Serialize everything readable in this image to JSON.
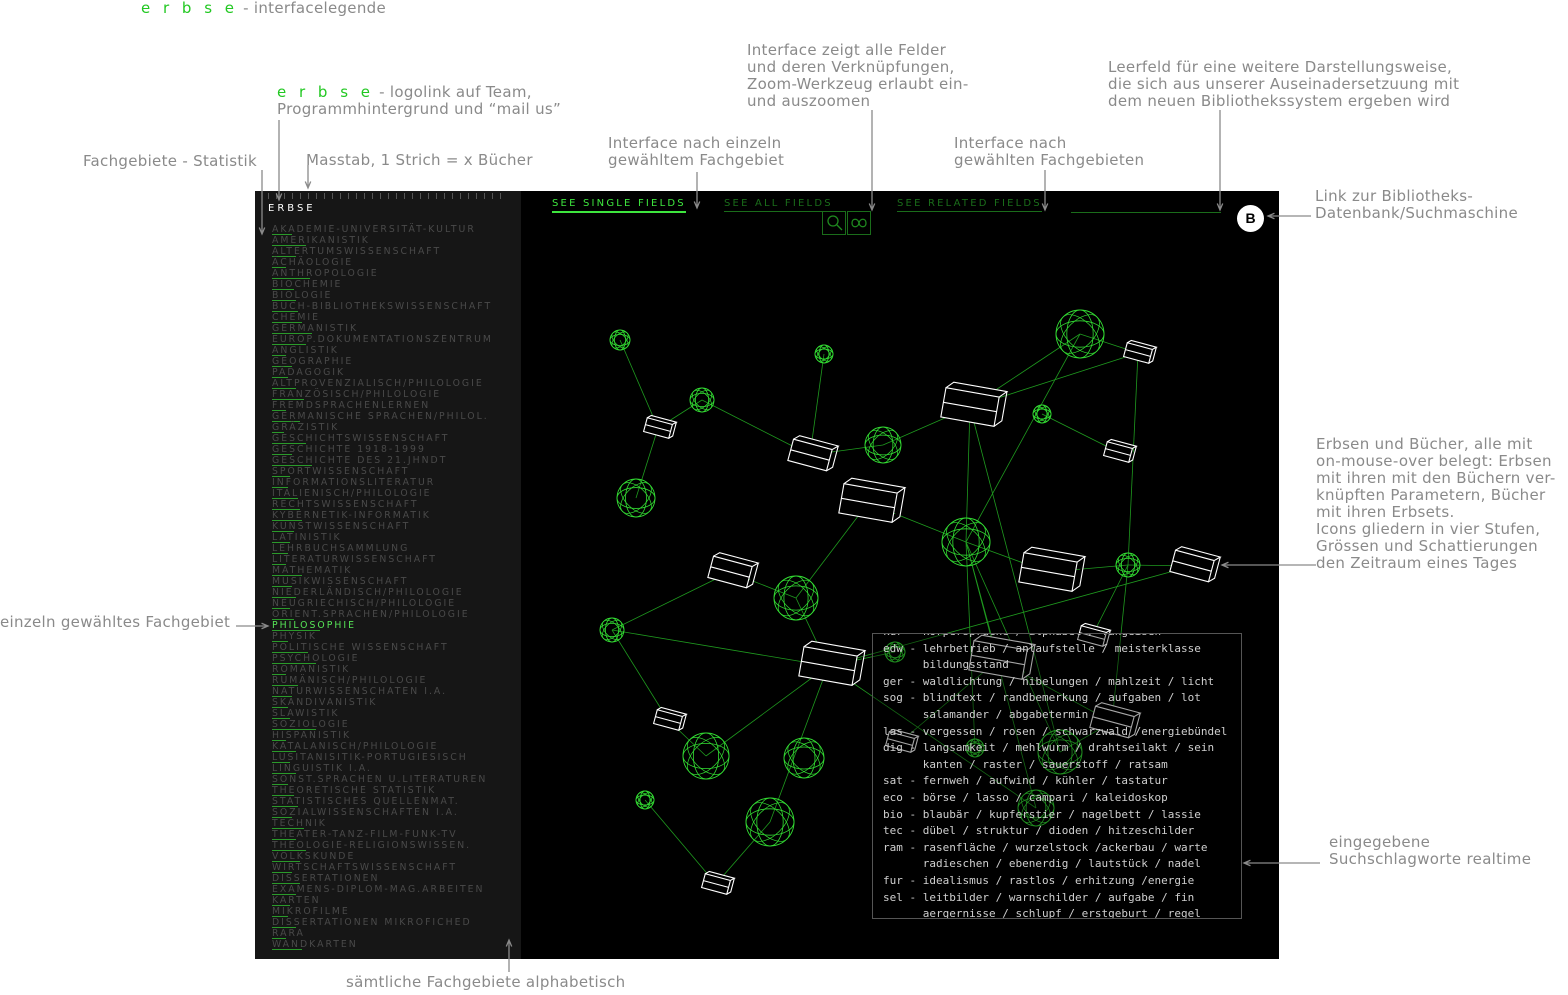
{
  "header": {
    "brand": "e r b s e",
    "title": " - interfacelegende"
  },
  "annotations": {
    "logolink_brand": "e r b s e",
    "logolink_text": " - logolink auf Team,\nProgrammhintergrund und “mail us”",
    "statistik": "Fachgebiete - Statistik",
    "masstab": "Masstab, 1 Strich = x Bücher",
    "single": "Interface nach einzeln\ngewähltem Fachgebiet",
    "all": "Interface zeigt alle Felder\nund deren Verknüpfungen,\nZoom-Werkzeug erlaubt ein-\nund auszoomen",
    "related": "Interface nach\ngewählten Fachgebieten",
    "leerfeld": "Leerfeld für eine weitere Darstellungsweise,\ndie sich aus unserer Auseinadersetzuung mit\ndem neuen Bibliothekssystem ergeben wird",
    "link": "Link zur Bibliotheks-\nDatenbank/Suchmaschine",
    "erbsen": "Erbsen und Bücher, alle mit\non-mouse-over belegt: Erbsen\nmit ihren mit den Büchern ver-\nknüpften Parametern, Bücher\nmit ihren Erbsets.\nIcons gliedern in vier Stufen,\nGrössen und Schattierungen\nden Zeitraum eines Tages",
    "einzeln": "einzeln gewähltes Fachgebiet",
    "suchschlag": "eingegebene\nSuchschlagworte realtime",
    "alphabetisch": "sämtliche Fachgebiete alphabetisch"
  },
  "app": {
    "logo": "ERBSE",
    "tabs": {
      "single": "SEE SINGLE FIELDS",
      "all": "SEE ALL FIELDS",
      "related": "SEE RELATED FIELDS"
    },
    "b_button": "B",
    "fields": [
      "AKADEMIE-UNIVERSITÄT-KULTUR",
      "AMERIKANISTIK",
      "ALTERTUMSWISSENSCHAFT",
      "ÄCHÄOLOGIE",
      "ANTHROPOLOGIE",
      "BIOCHEMIE",
      "BIOLOGIE",
      "BUCH-BIBLIOTHEKSWISSENSCHAFT",
      "CHEMIE",
      "GERMANISTIK",
      "EUROP.DOKUMENTATIONSZENTRUM",
      "ANGLISTIK",
      "GEOGRAPHIE",
      "PÄDAGOGIK",
      "ALTPROVENZIALISCH/PHILOLOGIE",
      "FRANZÖSISCH/PHILOLOGIE",
      "FREMDSPRACHENLERNEN",
      "GERMANISCHE SPRACHEN/PHILOL.",
      "GRÄZISTIK",
      "GESCHICHTSWISSENSCHAFT",
      "GESCHICHTE 1918-1999",
      "GESCHICHTE DES 21.JHNDT",
      "SPORTWISSENSCHAFT",
      "INFORMATIONSLITERATUR",
      "ITALIENISCH/PHILOLOGIE",
      "RECHTSWISSENSCHAFT",
      "KYBERNETIK-INFORMATIK",
      "KUNSTWISSENSCHAFT",
      "LATINISTIK",
      "LEHRBUCHSAMMLUNG",
      "LITERATURWISSENSCHAFT",
      "MATHEMATIK",
      "MUSIKWISSENSCHAFT",
      "NIEDERLÄNDISCH/PHILOLOGIE",
      "NEUGRIECHISCH/PHILOLOGIE",
      "ORIENT.SPRACHEN/PHILOLOGIE",
      "PHILOSOPHIE",
      "PHYSIK",
      "POLITISCHE WISSENSCHAFT",
      "PSYCHOLOGIE",
      "ROMANISTIK",
      "RUMÄNISCH/PHILOLOGIE",
      "NATURWISSENSCHATEN I.A.",
      "SKANDIVANISTIK",
      "SLAWISTIK",
      "SOZIOLOGIE",
      "HISPANISTIK",
      "KATALANISCH/PHILOLOGIE",
      "LUSITANISITIK-PORTUGIESISCH",
      "LINGUISTIK I.A.",
      "SONST.SPRACHEN U.LITERATUREN",
      "THEORETISCHE STATISTIK",
      "STATISTISCHES QUELLENMAT.",
      "SOZIALWISSENSCHAFTEN I.A.",
      "TECHNIK",
      "THEATER-TANZ-FILM-FUNK-TV",
      "THEOLOGIE-RELIGIONSWISSEN.",
      "VOLKSKUNDE",
      "WIRTSCHAFTSWISSENSCHAFT",
      "DISSERTATIONEN",
      "EXAMENS-DIPLOM-MAG.ARBEITEN",
      "KARTEN",
      "MIKROFILME",
      "DISSERTATIONEN MIKROFICHED",
      "RARA",
      "WANDKARTEN"
    ],
    "selected_index": 36,
    "search_lines": [
      "kur - körpersprache / alphabet / fangeisen",
      "edw - lehrbetrieb / anlaufstelle / meisterklasse",
      "      bildungsstand",
      "ger - waldlichtung / nibelungen / mahlzeit / licht",
      "sog - blindtext / randbemerkung / aufgaben / lot",
      "      salamander / abgabetermin",
      "las - vergessen / rosen / schwarzwald /energiebündel",
      "dig - langsamkeit / mehlwurm / drahtseilakt / sein",
      "      kanten / raster / sauerstoff / ratsam",
      "sat - fernweh / aufwind / kühler / tastatur",
      "eco - börse / lasso / campari / kaleidoskop",
      "bio - blaubär / kupferstier / nagelbett / lassie",
      "tec - dübel / struktur / dioden / hitzeschilder",
      "ram - rasenfläche / wurzelstock /ackerbau / warte",
      "      radieschen / ebenerdig / lautstück / nadel",
      "fur - idealismus / rastlos / erhitzung /energie",
      "sel - leitbilder / warnschilder / aufgabe / fin",
      "      aergernisse / schlupf / erstgeburt / regel"
    ]
  },
  "colors": {
    "accent": "#33dd33",
    "frame": "#000000",
    "sidebar": "#161616",
    "annotation": "#8a8a8a"
  }
}
